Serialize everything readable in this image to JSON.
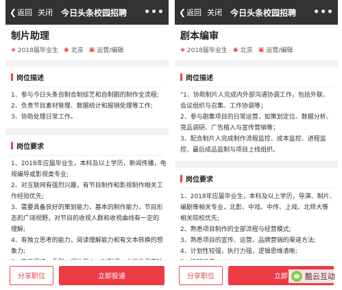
{
  "left": {
    "topbar": {
      "back_label": "返回",
      "close_label": "关闭",
      "title": "今日头条校园招聘",
      "more": "•••"
    },
    "job": {
      "title": "制片助理",
      "grade": "2018届毕业生",
      "location": "北京",
      "category": "运营/编辑"
    },
    "description": {
      "heading": "岗位描述",
      "lines": [
        "1、参与今日头条自制合制综艺和自制剧的制作全流程;",
        "2、负责节目素材管理、数据统计和报销处理等工作;",
        "3、协助处理日常工作。"
      ]
    },
    "requirements": {
      "heading": "岗位要求",
      "lines": [
        "1、2018年应届毕业生，本科及以上学历，新闻传播，电",
        "视编导或影视类专业;",
        "2、对互联网有强烈兴趣，有节目制作和影视制作相关工",
        "作经验优先;",
        "3、需要具备良好的策划能力，基本的制作能力，节目形",
        "态的广阔视野，对节目的收视人群和收视曲线有一定的",
        "理解;",
        "4、有独立思考的能力，阅读理解能力和有文本转换的想",
        "象力;",
        "5、热爱阅读，看剧，闪比题士，对影视，文学作品有独"
      ]
    },
    "footer": {
      "share_label": "分享职位",
      "apply_label": "立即投递"
    }
  },
  "right": {
    "topbar": {
      "back_label": "返回",
      "close_label": "关闭",
      "title": "今日头条校园招聘",
      "more": "•••"
    },
    "job": {
      "title": "剧本编审",
      "grade": "2018届毕业生",
      "location": "北京",
      "category": "运营/编辑"
    },
    "description": {
      "heading": "岗位描述",
      "lines": [
        "\"1、协助制片人完成内外部沟通协调工作，包括外联、",
        "会议组织与召集、工作协调等；",
        "2、参与剧集项目的日常运营，如策划定位、数据分析、",
        "竞品调研、广告植入与宣传营销等；",
        "3、配合制片人完成制作流程监控、成本监控、进程监",
        "控、最后成品监制与项目上线组织。"
      ]
    },
    "requirements": {
      "heading": "岗位要求",
      "lines": [
        "1、2018年应届毕业生，本科及以上学历，导演、制片、",
        "编剧等相关专业，北影、中戏、中传、上戏、北师大等",
        "相关院校优先;",
        "2、熟悉项目制作的全部流程与经营模式;",
        "3、熟悉项目的宣传、运营、品牌营销的渠道方法;",
        "4、计划性较强，执行力强，逻辑思维清晰;",
        "5、能够运用"
      ]
    },
    "footer": {
      "share_label": "分享职位",
      "apply_label": "立即"
    }
  },
  "watermark": {
    "text": "酷云互动"
  },
  "colors": {
    "accent": "#e8454a",
    "topbar": "#333333"
  }
}
